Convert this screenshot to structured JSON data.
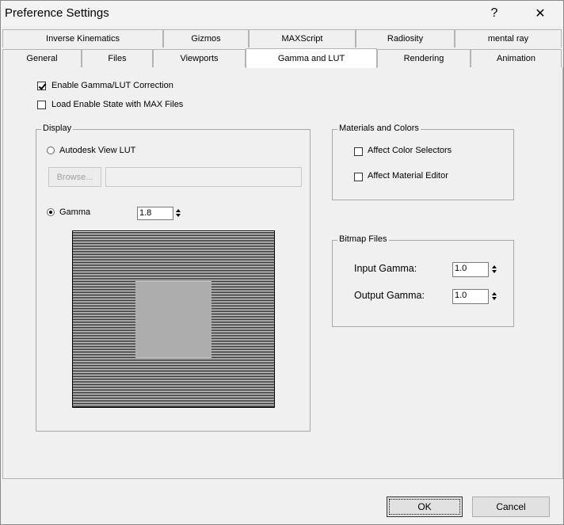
{
  "window": {
    "title": "Preference Settings",
    "help_glyph": "?",
    "close_glyph": "✕"
  },
  "tabs": {
    "row1": [
      "Inverse Kinematics",
      "Gizmos",
      "MAXScript",
      "Radiosity",
      "mental ray"
    ],
    "row2": [
      "General",
      "Files",
      "Viewports",
      "Gamma and LUT",
      "Rendering",
      "Animation"
    ],
    "active": "Gamma and LUT"
  },
  "options": {
    "enable_gamma_label": "Enable Gamma/LUT Correction",
    "enable_gamma_checked": true,
    "load_state_label": "Load Enable State with MAX Files",
    "load_state_checked": false
  },
  "display": {
    "title": "Display",
    "autodesk_lut_label": "Autodesk View LUT",
    "browse_label": "Browse...",
    "lut_path": "",
    "gamma_label": "Gamma",
    "gamma_value": "1.8",
    "selected_mode": "gamma"
  },
  "materials": {
    "title": "Materials and Colors",
    "affect_color_selectors_label": "Affect Color Selectors",
    "affect_color_selectors_checked": false,
    "affect_material_editor_label": "Affect Material Editor",
    "affect_material_editor_checked": false
  },
  "bitmap": {
    "title": "Bitmap Files",
    "input_gamma_label": "Input Gamma:",
    "input_gamma_value": "1.0",
    "output_gamma_label": "Output Gamma:",
    "output_gamma_value": "1.0"
  },
  "footer": {
    "ok_label": "OK",
    "cancel_label": "Cancel"
  },
  "icons": {
    "help": "help-icon",
    "close": "close-icon",
    "spinner": "spinner-arrows-icon"
  }
}
